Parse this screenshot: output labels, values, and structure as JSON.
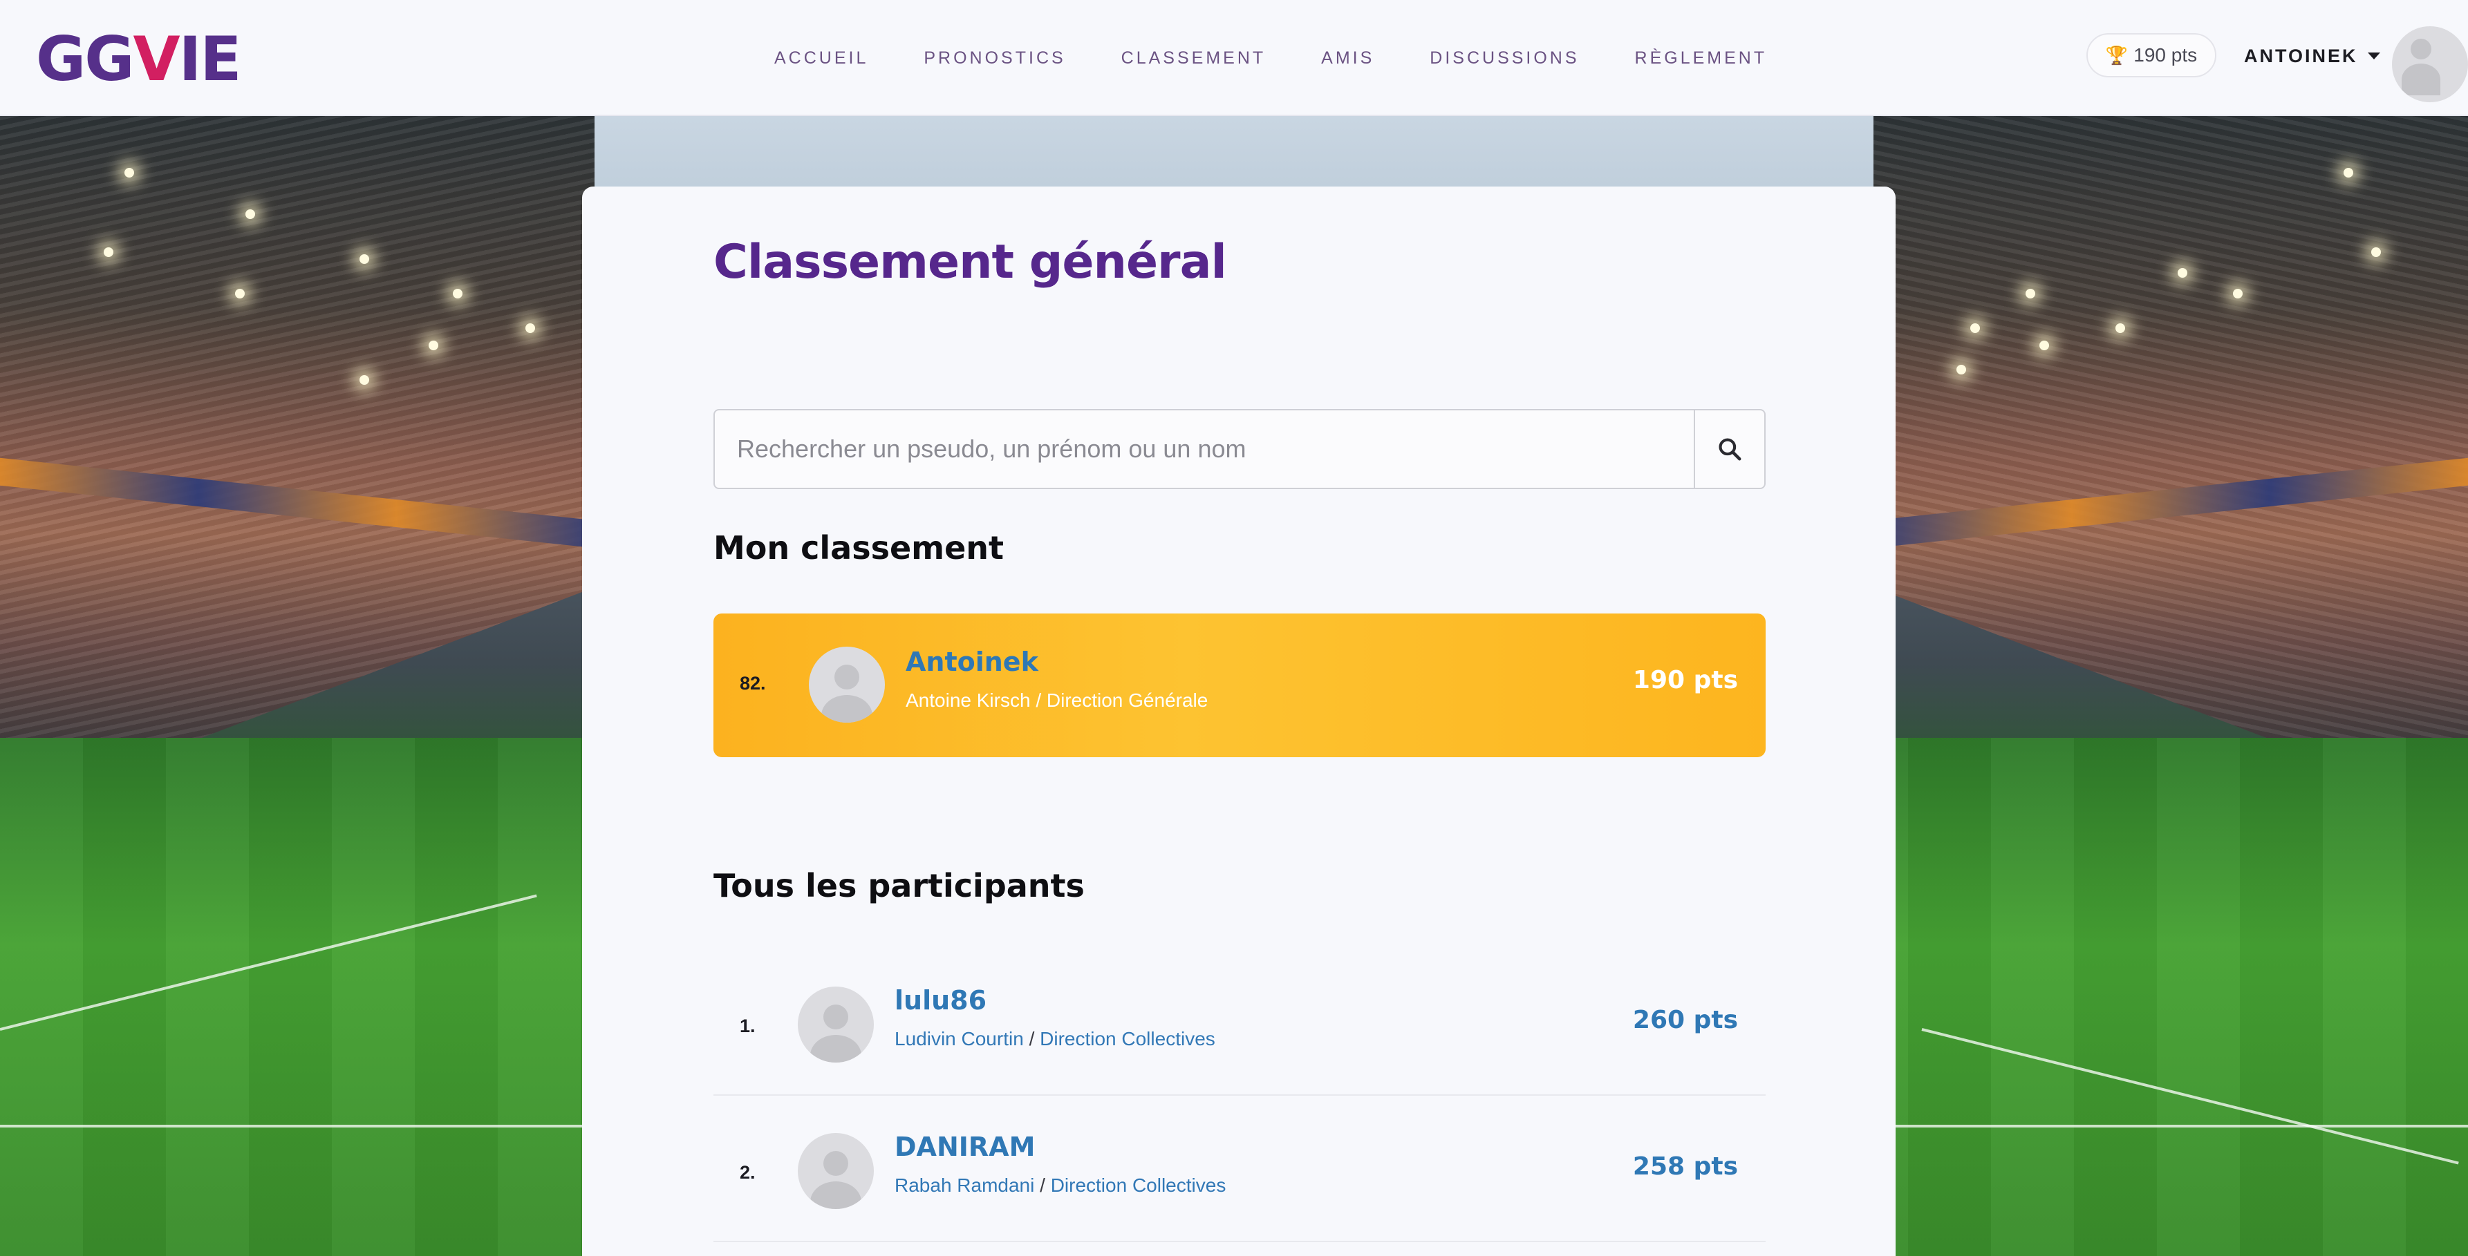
{
  "header": {
    "logo": {
      "prefix": "GG",
      "check": "V",
      "suffix": "IE"
    },
    "nav": [
      "ACCUEIL",
      "PRONOSTICS",
      "CLASSEMENT",
      "AMIS",
      "DISCUSSIONS",
      "RÈGLEMENT"
    ],
    "points_badge": "190 pts",
    "username": "ANTOINEK"
  },
  "page": {
    "title": "Classement général",
    "search_placeholder": "Rechercher un pseudo, un prénom ou un nom",
    "my_section_title": "Mon classement",
    "all_section_title": "Tous les participants"
  },
  "my_rank": {
    "rank": "82.",
    "pseudo": "Antoinek",
    "name": "Antoine Kirsch",
    "separator": "/",
    "department": "Direction Générale",
    "points": "190 pts"
  },
  "participants": [
    {
      "rank": "1.",
      "pseudo": "lulu86",
      "name": "Ludivin Courtin",
      "separator": "/",
      "department": "Direction Collectives",
      "points": "260 pts"
    },
    {
      "rank": "2.",
      "pseudo": "DANIRAM",
      "name": "Rabah Ramdani",
      "separator": "/",
      "department": "Direction Collectives",
      "points": "258 pts"
    }
  ],
  "colors": {
    "brand_purple": "#56278c",
    "logo_accent": "#d21f61",
    "highlight": "#fdb51f",
    "link_blue": "#2f78b5"
  }
}
